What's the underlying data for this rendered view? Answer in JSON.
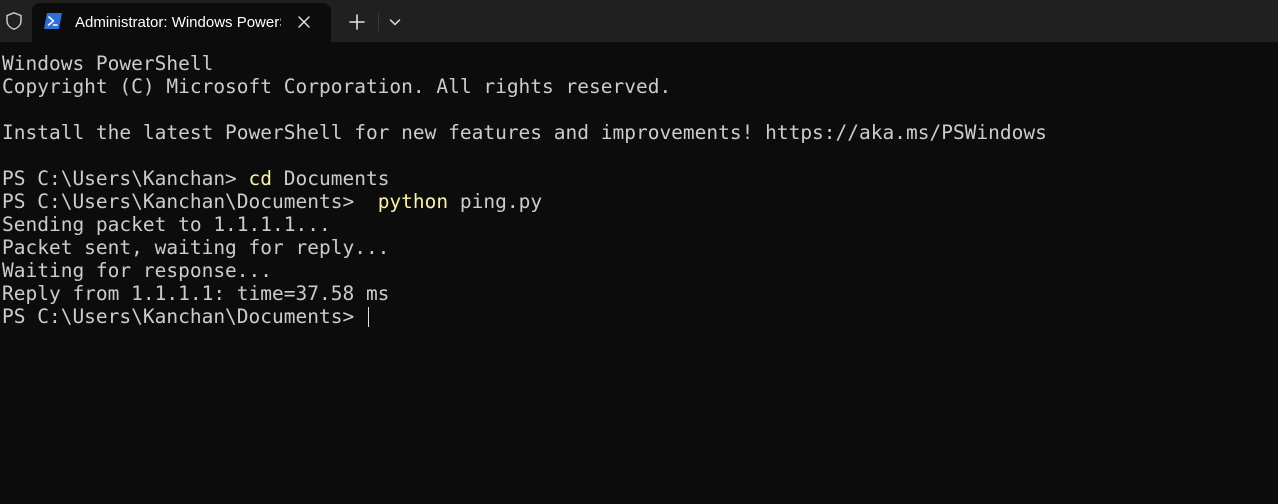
{
  "tabbar": {
    "tab_title": "Administrator: Windows PowerShell",
    "icons": [
      "shield-icon",
      "powershell-icon",
      "close-icon",
      "plus-icon",
      "chevron-down-icon"
    ]
  },
  "terminal": {
    "banner_title": "Windows PowerShell",
    "copyright": "Copyright (C) Microsoft Corporation. All rights reserved.",
    "install_notice": "Install the latest PowerShell for new features and improvements! https://aka.ms/PSWindows",
    "prompt1": "PS C:\\Users\\Kanchan> ",
    "cmd1_keyword": "cd",
    "cmd1_arg": " Documents",
    "prompt2": "PS C:\\Users\\Kanchan\\Documents>  ",
    "cmd2_keyword": "python",
    "cmd2_arg": " ping.py",
    "output": [
      "Sending packet to 1.1.1.1...",
      "Packet sent, waiting for reply...",
      "Waiting for response...",
      "Reply from 1.1.1.1: time=37.58 ms"
    ],
    "prompt3": "PS C:\\Users\\Kanchan\\Documents> "
  },
  "colors": {
    "background": "#0c0c0c",
    "tabbar": "#202020",
    "text": "#cccccc",
    "command": "#f9f1a5"
  }
}
